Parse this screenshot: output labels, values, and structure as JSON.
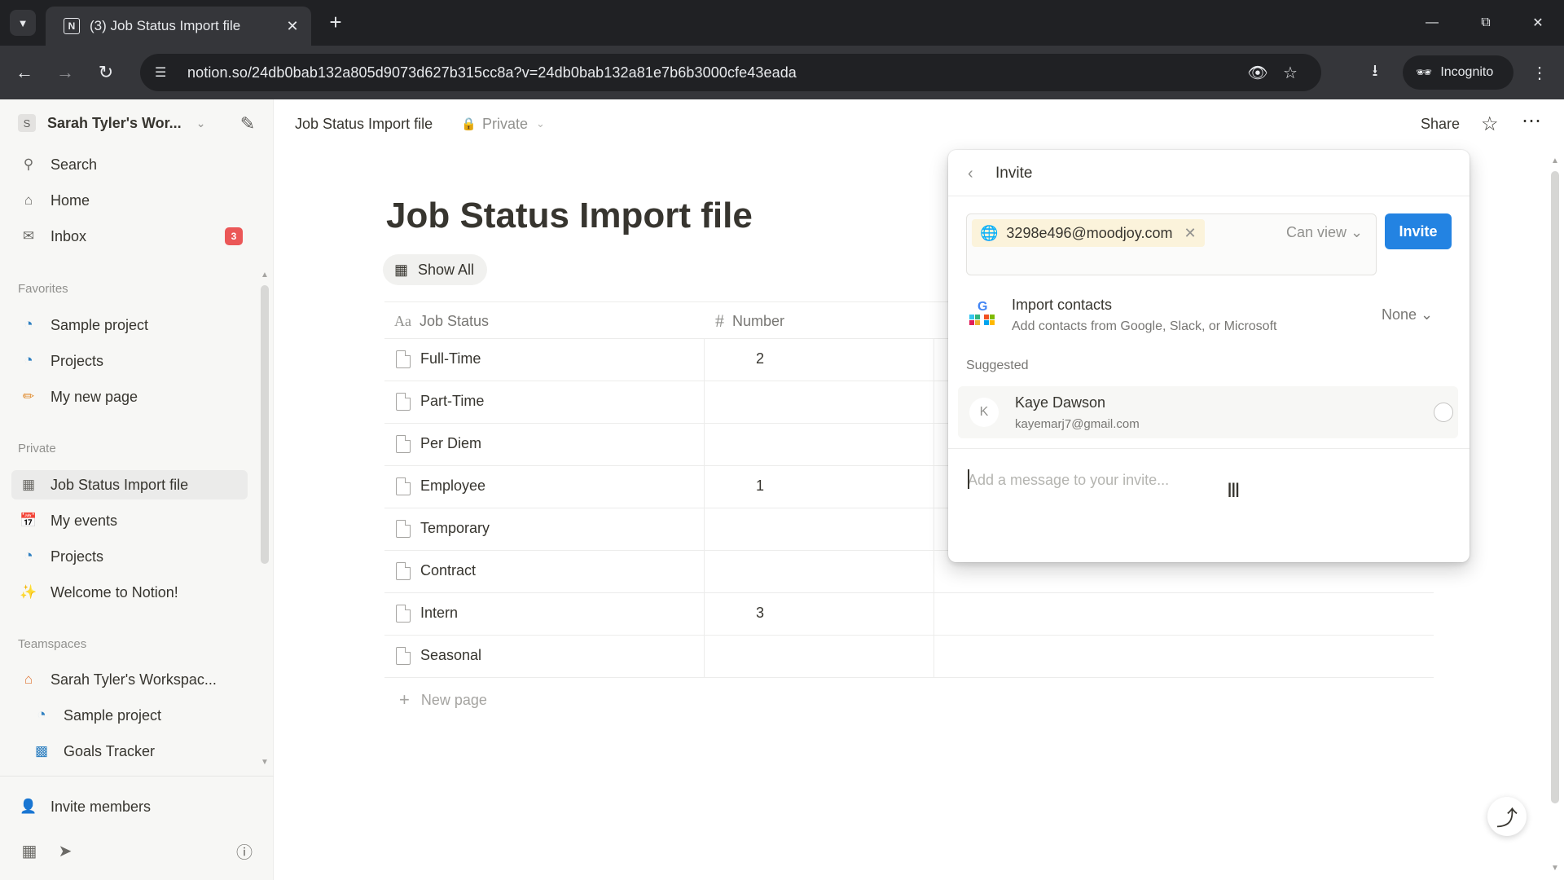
{
  "browser": {
    "tab_title": "(3) Job Status Import file",
    "url": "notion.so/24db0bab132a805d9073d627b315cc8a?v=24db0bab132a81e7b6b3000cfe43eada",
    "incognito_label": "Incognito",
    "favicon_letter": "N"
  },
  "sidebar": {
    "workspace_name": "Sarah Tyler's Wor...",
    "workspace_initial": "S",
    "top_items": [
      {
        "label": "Search",
        "icon": "search-icon"
      },
      {
        "label": "Home",
        "icon": "home-icon"
      },
      {
        "label": "Inbox",
        "icon": "inbox-icon",
        "badge": "3"
      }
    ],
    "favorites_label": "Favorites",
    "favorites": [
      {
        "label": "Sample project",
        "icon": "project-icon"
      },
      {
        "label": "Projects",
        "icon": "project-icon"
      },
      {
        "label": "My new page",
        "icon": "pencil-icon"
      }
    ],
    "private_label": "Private",
    "private": [
      {
        "label": "Job Status Import file",
        "icon": "table-icon"
      },
      {
        "label": "My events",
        "icon": "calendar-icon"
      },
      {
        "label": "Projects",
        "icon": "project-icon"
      },
      {
        "label": "Welcome to Notion!",
        "icon": "sparkle-icon"
      }
    ],
    "teamspaces_label": "Teamspaces",
    "teamspaces": [
      {
        "label": "Sarah Tyler's Workspac...",
        "icon": "home-icon"
      },
      {
        "label": "Sample project",
        "icon": "project-icon"
      },
      {
        "label": "Goals Tracker",
        "icon": "goals-icon"
      }
    ],
    "invite_members": "Invite members"
  },
  "topbar": {
    "breadcrumb": "Job Status Import file",
    "visibility": "Private",
    "share": "Share"
  },
  "page": {
    "title": "Job Status Import file",
    "view_tab": "Show All",
    "columns": [
      {
        "label": "Job Status",
        "icon": "Aa"
      },
      {
        "label": "Number",
        "icon": "#"
      }
    ],
    "rows": [
      {
        "name": "Full-Time",
        "number": "2"
      },
      {
        "name": "Part-Time",
        "number": ""
      },
      {
        "name": "Per Diem",
        "number": ""
      },
      {
        "name": "Employee",
        "number": "1"
      },
      {
        "name": "Temporary",
        "number": ""
      },
      {
        "name": "Contract",
        "number": ""
      },
      {
        "name": "Intern",
        "number": "3"
      },
      {
        "name": "Seasonal",
        "number": ""
      }
    ],
    "new_page": "New page"
  },
  "invite": {
    "title": "Invite",
    "email_chip": "3298e496@moodjoy.com",
    "permission": "Can view",
    "invite_button": "Invite",
    "import_title": "Import contacts",
    "import_subtitle": "Add contacts from Google, Slack, or Microsoft",
    "import_select": "None",
    "suggested_label": "Suggested",
    "suggested": [
      {
        "initial": "K",
        "name": "Kaye Dawson",
        "email": "kayemarj7@gmail.com"
      }
    ],
    "message_placeholder": "Add a message to your invite..."
  },
  "colors": {
    "accent": "#2383e2",
    "badge": "#eb5757",
    "sidebar_bg": "#f7f7f5",
    "chip_bg": "#fbf3db"
  }
}
